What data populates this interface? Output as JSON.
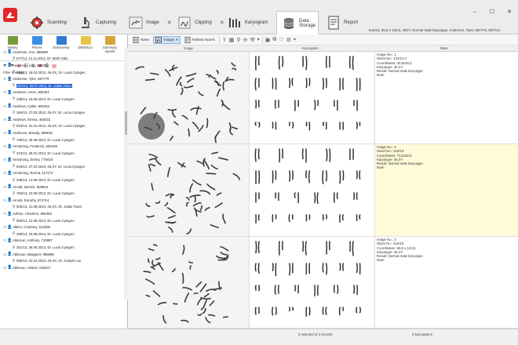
{
  "app": {
    "title": "544/13, 65,5 x 123,8, 46XY, Normal male karyotype, Anderson, Tyler, 587776, 8/27/12"
  },
  "modules": [
    {
      "label": "Scanning",
      "icon": "scanner-gear-icon"
    },
    {
      "label": "Capturing",
      "icon": "microscope-icon"
    },
    {
      "label": "Image",
      "icon": "chromosome-image-icon"
    },
    {
      "label": "Clipping",
      "icon": "clipping-icon"
    },
    {
      "label": "Karyogram",
      "icon": "karyogram-icon"
    },
    {
      "label": "Data Storage",
      "icon": "database-icon"
    },
    {
      "label": "Report",
      "icon": "report-icon"
    }
  ],
  "window_controls": [
    "–",
    "☐",
    "✕"
  ],
  "left_toolbar": [
    {
      "label": "History",
      "color": "#7a9a3a"
    },
    {
      "label": "Pisces",
      "color": "#3b8fe0"
    },
    {
      "label": "Dokumenty",
      "color": "#2f7bd3"
    },
    {
      "label": "DEMOLIC",
      "color": "#e8c54a"
    },
    {
      "label": "Summary reports",
      "color": "#d9a23a"
    }
  ],
  "filter_status": "Filter is empty",
  "tree": [
    {
      "kind": "patient",
      "text": "Anderson, Ann, 885588"
    },
    {
      "kind": "record",
      "text": "677/12, 14.11.2012, Dr. Mark Gale"
    },
    {
      "kind": "patient",
      "text": "Anderson, Lisa, 885002"
    },
    {
      "kind": "record",
      "text": "634/13, 18.04.2013, 46,XX, Dr. Lucia Cytogen"
    },
    {
      "kind": "patient",
      "text": "Anderson, Tyler, 587776"
    },
    {
      "kind": "record",
      "text": "827/13, 28.07.2013, Dr. Julian Team",
      "selected": true
    },
    {
      "kind": "patient",
      "text": "Andrews, Annie, 902051"
    },
    {
      "kind": "record",
      "text": "238/13, 15.05.2013, Dr. Lucia Cytogen"
    },
    {
      "kind": "patient",
      "text": "Andrews, Cable, 881054"
    },
    {
      "kind": "record",
      "text": "384/13, 27.03.2013, 46,XY, Dr. Lucia Cytogen"
    },
    {
      "kind": "patient",
      "text": "Andrews, Emma, 465031"
    },
    {
      "kind": "record",
      "text": "843/13, 31.01.2013, 46,XX, Dr. Lucia Cytogen"
    },
    {
      "kind": "patient",
      "text": "Anderson, Brandy, 588818"
    },
    {
      "kind": "record",
      "text": "780/13, 25.08.2013, Dr. Lucia Cytogen"
    },
    {
      "kind": "patient",
      "text": "Armstrong, Frederick, 653108"
    },
    {
      "kind": "record",
      "text": "373/13, 28.01.2013, Dr. Lucia Cytogen"
    },
    {
      "kind": "patient",
      "text": "Armstrong, Jimmy, 778418"
    },
    {
      "kind": "record",
      "text": "843/13, 27.03.2013, 46,XY, Dr. Lucia Cytogen"
    },
    {
      "kind": "patient",
      "text": "Armstrong, Norma, 117172"
    },
    {
      "kind": "record",
      "text": "238/13, 14.08.2013, Dr. Lucia Cytogen"
    },
    {
      "kind": "patient",
      "text": "Arnold, Derrick, 828824"
    },
    {
      "kind": "record",
      "text": "783/13, 24.08.2013, Dr. Lucia Cytogen"
    },
    {
      "kind": "patient",
      "text": "Arnold, Dorothy, 874714"
    },
    {
      "kind": "record",
      "text": "600/13, 31.05.2013, 46,XX, Dr. Julian Team"
    },
    {
      "kind": "patient",
      "text": "Ashton, Charlene, 855483"
    },
    {
      "kind": "record",
      "text": "828/13, 12.08.2013, Dr. Lucia Cytogen"
    },
    {
      "kind": "patient",
      "text": "Atkins, Courtney, 612308"
    },
    {
      "kind": "record",
      "text": "289/13, 19.08.2013, Dr. Lucia Cytogen"
    },
    {
      "kind": "patient",
      "text": "Atkinson, Anthony, 710887"
    },
    {
      "kind": "record",
      "text": "261/13, 28.05.2013, Dr. Lucia Cytogen"
    },
    {
      "kind": "patient",
      "text": "Atkinson, Margaret, 895898"
    },
    {
      "kind": "record",
      "text": "580/13, 02.04.2013, 46,XX, Dr. Joseph Lee"
    },
    {
      "kind": "patient",
      "text": "Atkinson, Valerie, 518017"
    }
  ],
  "main_toolbar": {
    "notes_label": "Notes",
    "images_label": "Images",
    "related_label": "Related reports"
  },
  "columns": {
    "image": "Image",
    "karyogram": "Karyogram",
    "data": "Data"
  },
  "rows": [
    {
      "selected": false,
      "data_lines": [
        "Image No.: 1",
        "Glass No.: 123/13 A",
        "Coordinates: 40,8x28,3",
        "Karyotype: 46,XY",
        "Result: Normal male karyotype",
        "Note:"
      ]
    },
    {
      "selected": true,
      "data_lines": [
        "Image No.: 2",
        "Glass No.: 544/13",
        "Coordinates: 73,5x32,8",
        "Karyotype: 46,XY",
        "Result: Normal male karyotype",
        "Note:"
      ]
    },
    {
      "selected": false,
      "data_lines": [
        "Image No.: 3",
        "Glass No.: 544/13",
        "Coordinates: 65,5 x 123,8",
        "Karyotype: 46,XY",
        "Result: Normal male karyotype",
        "Note:"
      ]
    }
  ],
  "status": {
    "left": "0 selected of 3 records",
    "right": "3 karyograms"
  },
  "colors": {
    "accent": "#1f5fd1",
    "selected_row": "#fffbd9",
    "logo": "#e3262a"
  }
}
